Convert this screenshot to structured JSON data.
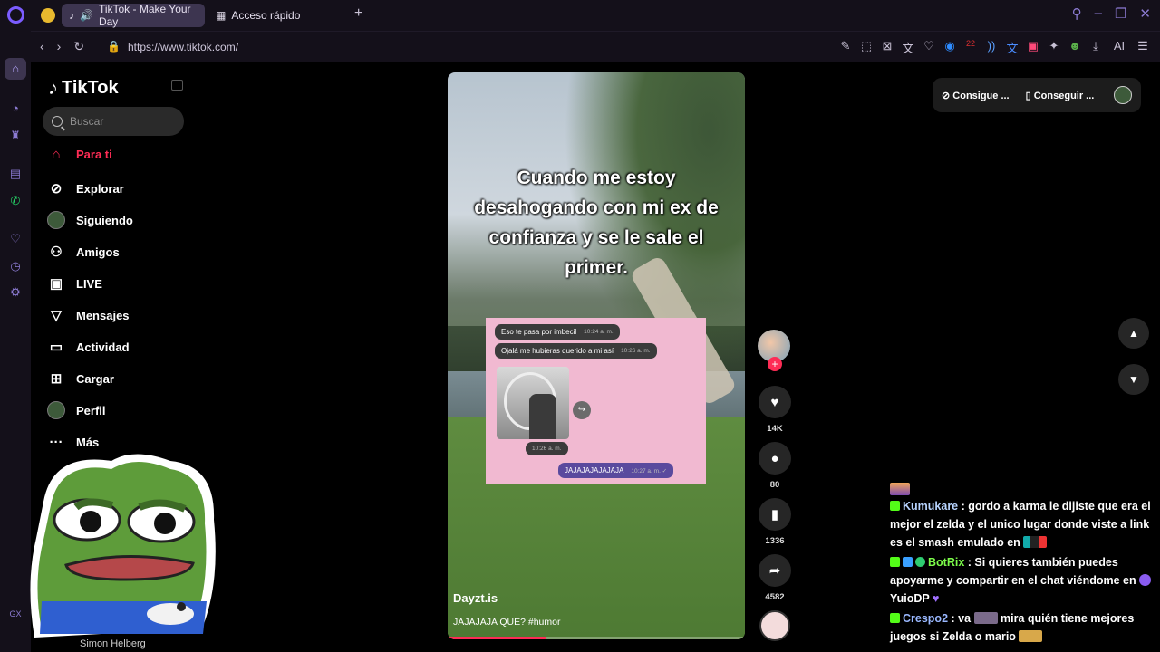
{
  "browser": {
    "tabs": [
      {
        "label": "TikTok - Make Your Day",
        "active": true
      },
      {
        "label": "Acceso rápido",
        "active": false
      }
    ],
    "url": "https://www.tiktok.com/",
    "ai_label": "AI",
    "ext_badge": "22"
  },
  "tiktok": {
    "logo": "TikTok",
    "search_placeholder": "Buscar",
    "nav": [
      {
        "label": "Para ti",
        "icon": "home-icon"
      },
      {
        "label": "Explorar",
        "icon": "compass-icon"
      },
      {
        "label": "Siguiendo",
        "icon": "following-avatar"
      },
      {
        "label": "Amigos",
        "icon": "friends-icon"
      },
      {
        "label": "LIVE",
        "icon": "live-icon"
      },
      {
        "label": "Mensajes",
        "icon": "messages-icon"
      },
      {
        "label": "Actividad",
        "icon": "activity-icon"
      },
      {
        "label": "Cargar",
        "icon": "upload-icon"
      },
      {
        "label": "Perfil",
        "icon": "profile-avatar"
      },
      {
        "label": "Más",
        "icon": "more-icon"
      }
    ],
    "streamer_name": "Simon Helberg",
    "top_right": {
      "btn1": "Consigue ...",
      "btn2": "Conseguir ..."
    },
    "video": {
      "caption": "Cuando me estoy desahogando con mi ex de confianza y se le sale el primer.",
      "chat": {
        "msg1": "Eso te pasa por imbecil",
        "time1": "10:24 a. m.",
        "msg2": "Ojalá me hubieras querido a mi así",
        "time2": "10:26 a. m.",
        "time3": "10:26 a. m.",
        "msg4": "JAJAJAJAJAJAJA",
        "time4": "10:27 a. m. ✓"
      },
      "username": "Dayzt.is",
      "description": "JAJAJAJA QUE? #humor",
      "progress": 0.33
    },
    "actions": {
      "likes": "14K",
      "comments": "80",
      "saves": "1336",
      "shares": "4582"
    }
  },
  "stream_chat": [
    {
      "user": "Kumukare",
      "text": ": gordo a karma le dijiste que era el mejor el zelda y el unico lugar donde viste a link es el smash emulado en"
    },
    {
      "user": "BotRix",
      "text": ": Si quieres también puedes apoyarme y compartir en el chat viéndome en",
      "tail": "YuioDP"
    },
    {
      "user": "Crespo2",
      "text": ": va",
      "text2": "mira quién tiene mejores juegos si Zelda o mario"
    }
  ]
}
